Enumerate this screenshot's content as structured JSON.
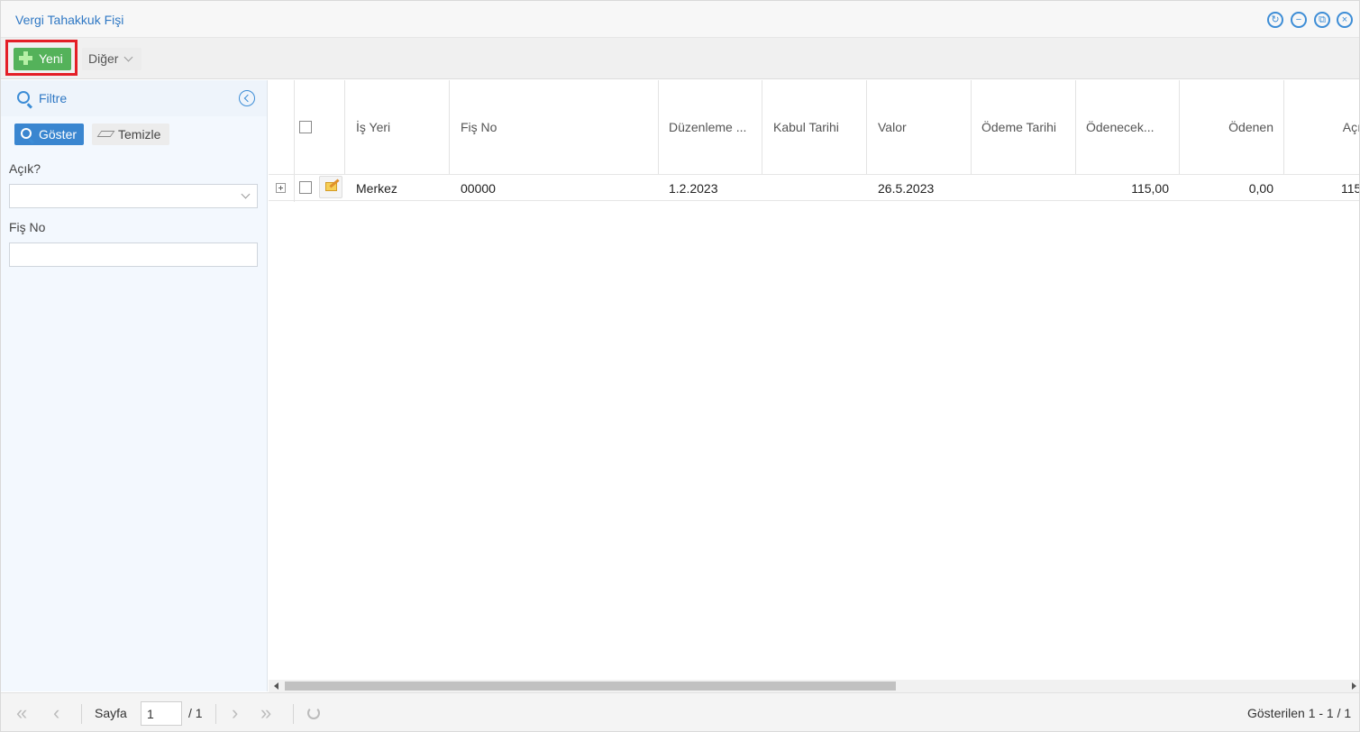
{
  "window": {
    "title": "Vergi Tahakkuk Fişi",
    "controls": [
      "refresh-icon",
      "minimize-icon",
      "restore-icon",
      "close-icon"
    ]
  },
  "toolbar": {
    "new_label": "Yeni",
    "other_label": "Diğer"
  },
  "filter": {
    "title": "Filtre",
    "show_label": "Göster",
    "clear_label": "Temizle",
    "fields": [
      {
        "label": "Açık?",
        "value": ""
      },
      {
        "label": "Fiş No",
        "value": ""
      }
    ]
  },
  "grid": {
    "columns": [
      "İş Yeri",
      "Fiş No",
      "Düzenleme ...",
      "Kabul Tarihi",
      "Valor",
      "Ödeme Tarihi",
      "Ödenecek...",
      "Ödenen",
      "Açı"
    ],
    "rows": [
      {
        "is_yeri": "Merkez",
        "fis_no": "00000",
        "duzenleme": "1.2.2023",
        "kabul": "",
        "valor": "26.5.2023",
        "odeme_tarihi": "",
        "odenecek": "115,00",
        "odenen": "0,00",
        "acik": "115"
      }
    ]
  },
  "pager": {
    "page_label": "Sayfa",
    "page_value": "1",
    "page_total": "/ 1",
    "summary": "Gösterilen 1 - 1 / 1"
  },
  "colors": {
    "accent": "#3d8dd6",
    "new_button": "#54b25a",
    "highlight": "#e41e26"
  }
}
